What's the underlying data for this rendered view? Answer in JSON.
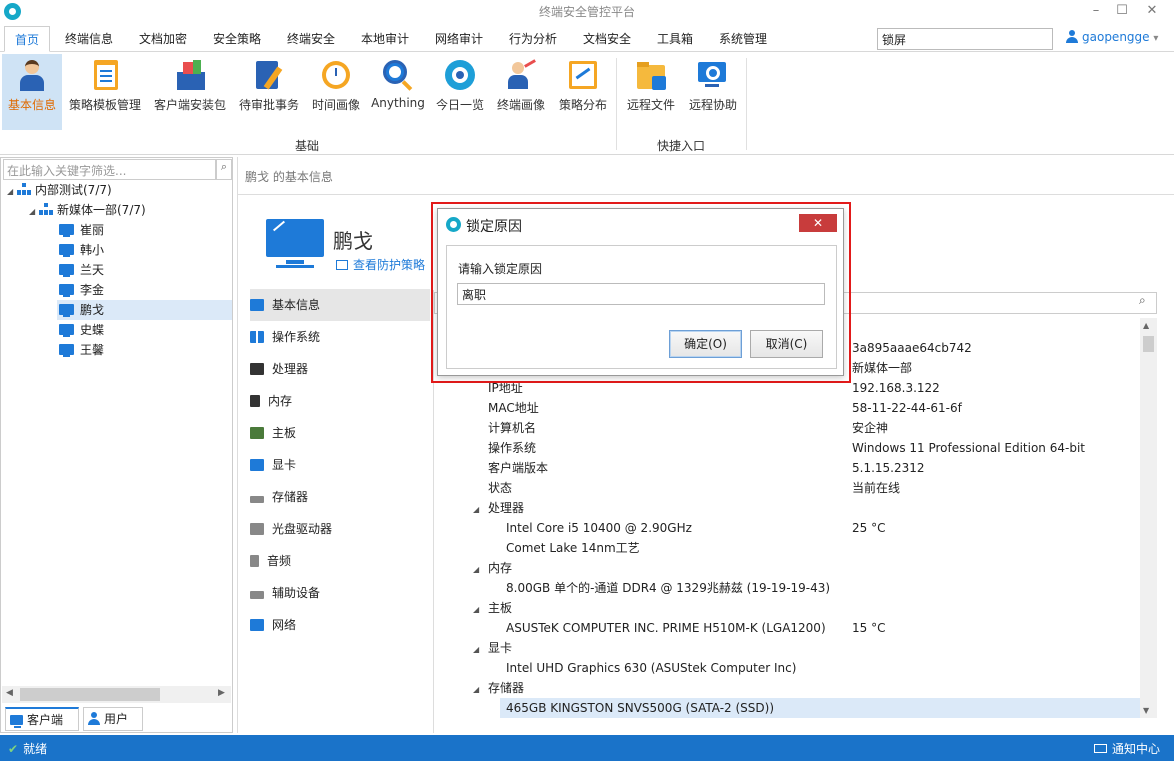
{
  "window": {
    "title": "终端安全管控平台",
    "minimize": "–",
    "maximize": "☐",
    "close": "✕"
  },
  "menu": [
    "首页",
    "终端信息",
    "文档加密",
    "安全策略",
    "终端安全",
    "本地审计",
    "网络审计",
    "行为分析",
    "文档安全",
    "工具箱",
    "系统管理"
  ],
  "search": {
    "value": "锁屏"
  },
  "user": {
    "name": "gaopengge",
    "caret": "▾"
  },
  "ribbon": {
    "items": [
      "基本信息",
      "策略模板管理",
      "客户端安装包",
      "待审批事务",
      "时间画像",
      "Anything",
      "今日一览",
      "终端画像",
      "策略分布",
      "远程文件",
      "远程协助"
    ],
    "groups": [
      "基础",
      "快捷入口"
    ]
  },
  "left": {
    "filter_placeholder": "在此输入关键字筛选...",
    "filter_icon": "⌕",
    "root": "内部测试(7/7)",
    "dept": "新媒体一部(7/7)",
    "users": [
      "崔丽",
      "韩小",
      "兰天",
      "李金",
      "鹏戈",
      "史蝶",
      "王馨"
    ],
    "tabs": [
      "客户端",
      "用户"
    ]
  },
  "main": {
    "crumb": "鹏戈 的基本信息",
    "pc_name": "鹏戈",
    "policy_link": "查看防护策略",
    "categories": [
      "基本信息",
      "操作系统",
      "处理器",
      "内存",
      "主板",
      "显卡",
      "存储器",
      "光盘驱动器",
      "音频",
      "辅助设备",
      "网络"
    ],
    "search_icon": "⌕"
  },
  "details": {
    "right_col": [
      "3a895aaae64cb742",
      "新媒体一部",
      "192.168.3.122"
    ],
    "rows": [
      {
        "label": "MAC地址",
        "value": "58-11-22-44-61-6f"
      },
      {
        "label": "计算机名",
        "value": "安企神"
      },
      {
        "label": "操作系统",
        "value": "Windows 11 Professional Edition 64-bit"
      },
      {
        "label": "客户端版本",
        "value": "5.1.15.2312"
      },
      {
        "label": "状态",
        "value": "当前在线"
      }
    ],
    "ip_label": "IP地址",
    "cpu_header": "处理器",
    "cpu_line1": "Intel Core i5 10400 @ 2.90GHz",
    "cpu_temp": "25 °C",
    "cpu_line2": "Comet Lake 14nm工艺",
    "mem_header": "内存",
    "mem_line": "8.00GB 单个的-通道 DDR4 @ 1329兆赫兹 (19-19-19-43)",
    "board_header": "主板",
    "board_line": "ASUSTeK COMPUTER INC. PRIME H510M-K (LGA1200)",
    "board_temp": "15 °C",
    "gpu_header": "显卡",
    "gpu_line": "Intel UHD Graphics 630 (ASUStek Computer Inc)",
    "storage_header": "存储器",
    "storage_line": "465GB KINGSTON SNVS500G (SATA-2 (SSD))"
  },
  "dialog": {
    "title": "锁定原因",
    "close": "✕",
    "label": "请输入锁定原因",
    "value": "离职",
    "ok": "确定(O)",
    "cancel": "取消(C)"
  },
  "status": {
    "left": "就绪",
    "check": "✔",
    "right": "通知中心"
  },
  "colors": {
    "accent": "#1e7ad8",
    "statusbar": "#1a73c9",
    "highlight_frame": "#e21a1a"
  }
}
